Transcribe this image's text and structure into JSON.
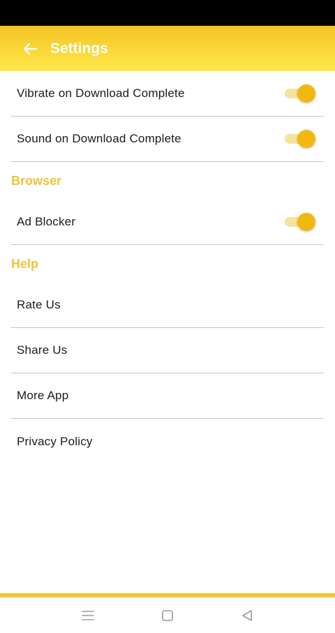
{
  "app_bar": {
    "title": "Settings",
    "background_start": "#f6c325",
    "background_end": "#fde84a"
  },
  "settings": [
    {
      "label": "Vibrate on Download Complete",
      "toggle": true
    },
    {
      "label": "Sound on Download Complete",
      "toggle": true
    }
  ],
  "sections": [
    {
      "title": "Browser",
      "items": [
        {
          "label": "Ad Blocker",
          "toggle": true
        }
      ]
    },
    {
      "title": "Help",
      "items": [
        {
          "label": "Rate Us"
        },
        {
          "label": "Share Us"
        },
        {
          "label": "More App"
        },
        {
          "label": "Privacy Policy"
        }
      ]
    }
  ],
  "icons": {
    "back": "arrow-left-icon",
    "nav_menu": "menu-lines-icon",
    "nav_home": "square-home-icon",
    "nav_back": "triangle-back-icon"
  },
  "colors": {
    "accent": "#f3b80e",
    "section_header": "#f0c33a",
    "toggle_track": "#f7e3a0"
  }
}
